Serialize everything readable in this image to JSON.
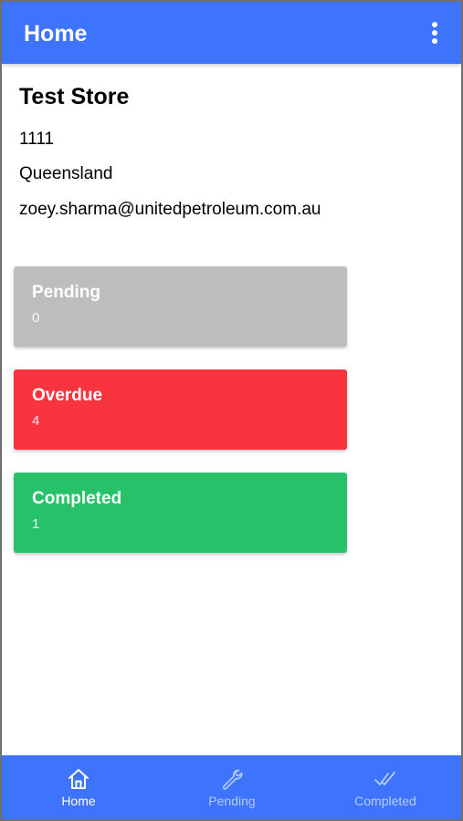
{
  "app_bar": {
    "title": "Home",
    "menu_icon": "more-vertical-icon"
  },
  "store": {
    "name": "Test Store",
    "code": "1111",
    "region": "Queensland",
    "email": "zoey.sharma@unitedpetroleum.com.au"
  },
  "cards": [
    {
      "title": "Pending",
      "count": "0",
      "color": "#bdbdbd"
    },
    {
      "title": "Overdue",
      "count": "4",
      "color": "#f8343f"
    },
    {
      "title": "Completed",
      "count": "1",
      "color": "#27c16a"
    }
  ],
  "bottom_nav": {
    "accent": "#3d74fb",
    "items": [
      {
        "label": "Home",
        "icon": "home-icon",
        "active": true
      },
      {
        "label": "Pending",
        "icon": "wrench-icon",
        "active": false
      },
      {
        "label": "Completed",
        "icon": "double-check-icon",
        "active": false
      }
    ]
  }
}
